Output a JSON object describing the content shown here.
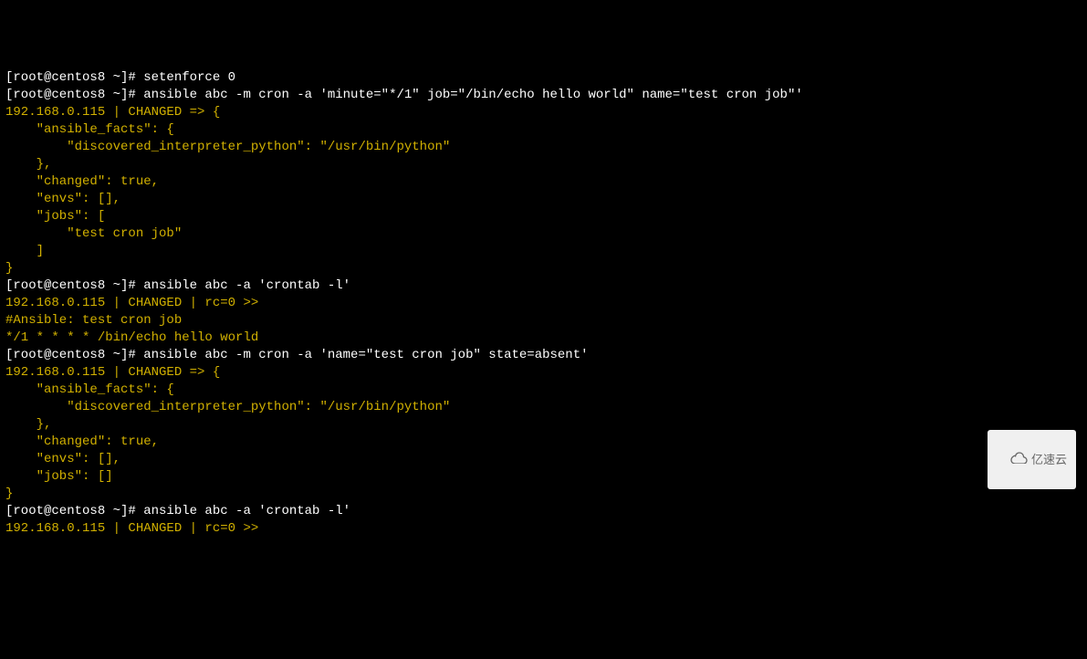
{
  "terminal": {
    "lines": [
      {
        "segments": [
          {
            "cls": "white",
            "text": "[root@centos8 ~]# setenforce 0"
          }
        ]
      },
      {
        "segments": [
          {
            "cls": "white",
            "text": "[root@centos8 ~]# ansible abc -m cron -a 'minute=\"*/1\" job=\"/bin/echo hello world\" name=\"test cron job\"'"
          }
        ]
      },
      {
        "segments": [
          {
            "cls": "yellow",
            "text": "192.168.0.115 | CHANGED => {"
          }
        ]
      },
      {
        "segments": [
          {
            "cls": "yellow",
            "text": "    \"ansible_facts\": {"
          }
        ]
      },
      {
        "segments": [
          {
            "cls": "yellow",
            "text": "        \"discovered_interpreter_python\": \"/usr/bin/python\""
          }
        ]
      },
      {
        "segments": [
          {
            "cls": "yellow",
            "text": "    },"
          }
        ]
      },
      {
        "segments": [
          {
            "cls": "yellow",
            "text": "    \"changed\": true,"
          }
        ]
      },
      {
        "segments": [
          {
            "cls": "yellow",
            "text": "    \"envs\": [],"
          }
        ]
      },
      {
        "segments": [
          {
            "cls": "yellow",
            "text": "    \"jobs\": ["
          }
        ]
      },
      {
        "segments": [
          {
            "cls": "yellow",
            "text": "        \"test cron job\""
          }
        ]
      },
      {
        "segments": [
          {
            "cls": "yellow",
            "text": "    ]"
          }
        ]
      },
      {
        "segments": [
          {
            "cls": "yellow",
            "text": "}"
          }
        ]
      },
      {
        "segments": [
          {
            "cls": "white",
            "text": "[root@centos8 ~]# ansible abc -a 'crontab -l'"
          }
        ]
      },
      {
        "segments": [
          {
            "cls": "yellow",
            "text": "192.168.0.115 | CHANGED | rc=0 >>"
          }
        ]
      },
      {
        "segments": [
          {
            "cls": "yellow",
            "text": "#Ansible: test cron job"
          }
        ]
      },
      {
        "segments": [
          {
            "cls": "yellow",
            "text": "*/1 * * * * /bin/echo hello world"
          }
        ]
      },
      {
        "segments": [
          {
            "cls": "white",
            "text": ""
          }
        ]
      },
      {
        "segments": [
          {
            "cls": "white",
            "text": "[root@centos8 ~]# ansible abc -m cron -a 'name=\"test cron job\" state=absent'"
          }
        ]
      },
      {
        "segments": [
          {
            "cls": "yellow",
            "text": "192.168.0.115 | CHANGED => {"
          }
        ]
      },
      {
        "segments": [
          {
            "cls": "yellow",
            "text": "    \"ansible_facts\": {"
          }
        ]
      },
      {
        "segments": [
          {
            "cls": "yellow",
            "text": "        \"discovered_interpreter_python\": \"/usr/bin/python\""
          }
        ]
      },
      {
        "segments": [
          {
            "cls": "yellow",
            "text": "    },"
          }
        ]
      },
      {
        "segments": [
          {
            "cls": "yellow",
            "text": "    \"changed\": true,"
          }
        ]
      },
      {
        "segments": [
          {
            "cls": "yellow",
            "text": "    \"envs\": [],"
          }
        ]
      },
      {
        "segments": [
          {
            "cls": "yellow",
            "text": "    \"jobs\": []"
          }
        ]
      },
      {
        "segments": [
          {
            "cls": "yellow",
            "text": "}"
          }
        ]
      },
      {
        "segments": [
          {
            "cls": "white",
            "text": "[root@centos8 ~]# ansible abc -a 'crontab -l'"
          }
        ]
      },
      {
        "segments": [
          {
            "cls": "yellow",
            "text": "192.168.0.115 | CHANGED | rc=0 >>"
          }
        ]
      }
    ]
  },
  "watermark": {
    "text": "亿速云"
  }
}
